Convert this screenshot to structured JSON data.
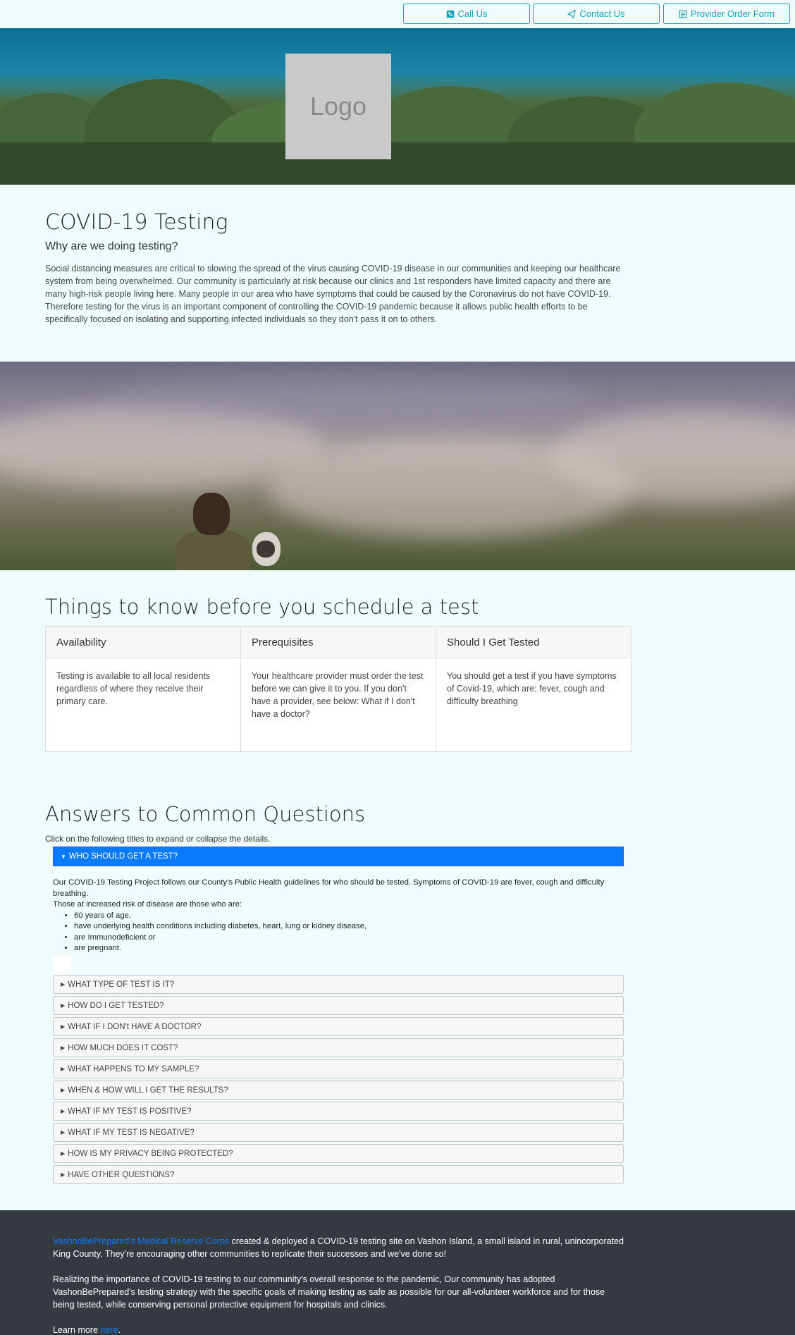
{
  "header": {
    "buttons": [
      {
        "label": "Call Us",
        "icon": "phone-icon"
      },
      {
        "label": "Contact Us",
        "icon": "paper-plane-icon"
      },
      {
        "label": "Provider Order Form",
        "icon": "form-icon"
      }
    ],
    "logo_text": "Logo"
  },
  "intro": {
    "title": "COVID-19 Testing",
    "subtitle": "Why are we doing testing?",
    "body": "Social distancing measures are critical to slowing the spread of the virus causing COVID-19 disease in our communities and keeping our healthcare system from being overwhelmed. Our community is particularly at risk because our clinics and 1st responders have limited capacity and there are many high-risk people living here. Many people in our area who have symptoms that could be caused by the Coronavirus do not have COVID-19. Therefore testing for the virus is an important component of controlling the COVID-19 pandemic because it allows public health efforts to be specifically focused on isolating and supporting infected individuals so they don't pass it on to others."
  },
  "things": {
    "title": "Things to know before you schedule a test",
    "cards": [
      {
        "header": "Availability",
        "body": "Testing is available to all local residents regardless of where they receive their primary care."
      },
      {
        "header": "Prerequisites",
        "body": "Your healthcare provider must order the test before we can give it to you. If you don't have a provider, see below: What if I don't have a doctor?"
      },
      {
        "header": "Should I Get Tested",
        "body": "You should get a test if you have symptoms of Covid-19, which are: fever, cough and difficulty breathing"
      }
    ]
  },
  "faq": {
    "title": "Answers to Common Questions",
    "help": "Click on the following titles to expand or collapse the details.",
    "active": {
      "title": "WHO SHOULD GET A TEST?",
      "p1": "Our COVID-19 Testing Project follows our County's Public Health guidelines for who should be tested. Symptoms of COVID-19 are fever, cough and difficulty breathing.",
      "p2": "Those at increased risk of disease are those who are:",
      "list": [
        "60 years of age,",
        "have underlying health conditions including diabetes, heart, lung or kidney disease,",
        "are Immunodeficient or",
        "are pregnant."
      ]
    },
    "items": [
      "WHAT TYPE OF TEST IS IT?",
      "HOW DO I GET TESTED?",
      "WHAT IF I DON't HAVE A DOCTOR?",
      "HOW MUCH DOES IT COST?",
      "WHAT HAPPENS TO MY SAMPLE?",
      "WHEN & HOW WILL I GET THE RESULTS?",
      "WHAT IF MY TEST IS POSITIVE?",
      "WHAT IF MY TEST IS NEGATIVE?",
      "HOW IS MY PRIVACY BEING PROTECTED?",
      "HAVE OTHER QUESTIONS?"
    ]
  },
  "footer": {
    "link1": "VashonBePrepared's Medical Reserve Corps",
    "p1_rest": " created & deployed a COVID-19 testing site on Vashon Island, a small island in rural, unincorporated King County. They're encouraging other communities to replicate their successes and we've done so!",
    "p2": "Realizing the importance of COVID-19 testing to our community's overall response to the pandemic, Our community has adopted VashonBePrepared's testing strategy with the specific goals of making testing as safe as possible for our all-volunteer workforce and for those being tested, while conserving personal protective equipment for hospitals and clinics.",
    "learn_prefix": "Learn more ",
    "learn_link": "here",
    "learn_suffix": "."
  },
  "colors": {
    "accent": "#17a2b8",
    "active_accordion": "#0a7bff",
    "footer_bg": "#343a40",
    "page_bg": "#f0fcfc"
  }
}
